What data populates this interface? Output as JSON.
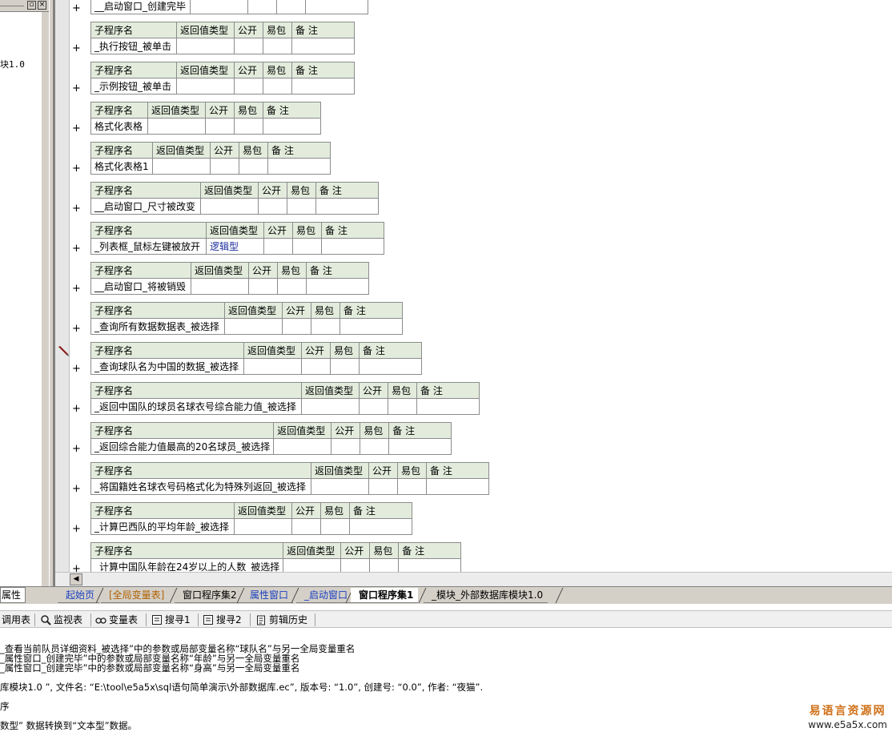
{
  "left_panel": {
    "version_text": "块1.0",
    "tab_label": "属性"
  },
  "table_header": {
    "name": "子程序名",
    "ret": "返回值类型",
    "pub": "公开",
    "easy": "易包",
    "note": "备 注"
  },
  "subs": [
    {
      "name": "__启动窗口_创建完毕",
      "ret": ""
    },
    {
      "name": "_执行按钮_被单击",
      "ret": ""
    },
    {
      "name": "_示例按钮_被单击",
      "ret": ""
    },
    {
      "name": "格式化表格",
      "ret": ""
    },
    {
      "name": "格式化表格1",
      "ret": ""
    },
    {
      "name": "__启动窗口_尺寸被改变",
      "ret": ""
    },
    {
      "name": "_列表框_鼠标左键被放开",
      "ret": "逻辑型"
    },
    {
      "name": "__启动窗口_将被销毁",
      "ret": ""
    },
    {
      "name": "_查询所有数据数据表_被选择",
      "ret": ""
    },
    {
      "name": "_查询球队名为中国的数据_被选择",
      "ret": ""
    },
    {
      "name": "_返回中国队的球员名球衣号综合能力值_被选择",
      "ret": ""
    },
    {
      "name": "_返回综合能力值最高的20名球员_被选择",
      "ret": ""
    },
    {
      "name": "_将国籍姓名球衣号码格式化为特殊列返回_被选择",
      "ret": ""
    },
    {
      "name": "_计算巴西队的平均年龄_被选择",
      "ret": ""
    },
    {
      "name": "_计算中国队年龄在24岁以上的人数_被选择",
      "ret": ""
    }
  ],
  "tabs": [
    {
      "label": "起始页"
    },
    {
      "label": "[全局变量表]"
    },
    {
      "label": "窗口程序集2"
    },
    {
      "label": "属性窗口"
    },
    {
      "label": "_启动窗口"
    },
    {
      "label": "窗口程序集1"
    },
    {
      "label": "_模块_外部数据库模块1.0"
    }
  ],
  "toolbar": [
    {
      "label": "调用表",
      "icon": "call-table-icon"
    },
    {
      "label": "监视表",
      "icon": "magnifier-icon"
    },
    {
      "label": "变量表",
      "icon": "variable-icon"
    },
    {
      "label": "搜寻1",
      "icon": "search1-icon"
    },
    {
      "label": "搜寻2",
      "icon": "search2-icon"
    },
    {
      "label": "剪辑历史",
      "icon": "clipboard-icon"
    }
  ],
  "messages": [
    "_查看当前队员详细资料_被选择”中的参数或局部变量名称“球队名”与另一全局变量重名",
    "_属性窗口_创建完毕”中的参数或局部变量名称“年龄”与另一全局变量重名",
    "_属性窗口_创建完毕”中的参数或局部变量名称“身高”与另一全局变量重名",
    "库模块1.0 ”, 文件名: “E:\\tool\\e5a5x\\sql语句简单演示\\外部数据库.ec”, 版本号: “1.0”, 创建号: “0.0”, 作者: “夜猫”.",
    "序",
    "数型” 数据转换到“文本型”数据。"
  ],
  "watermark": {
    "cn": "易语言资源网",
    "url": "www.e5a5x.com"
  }
}
